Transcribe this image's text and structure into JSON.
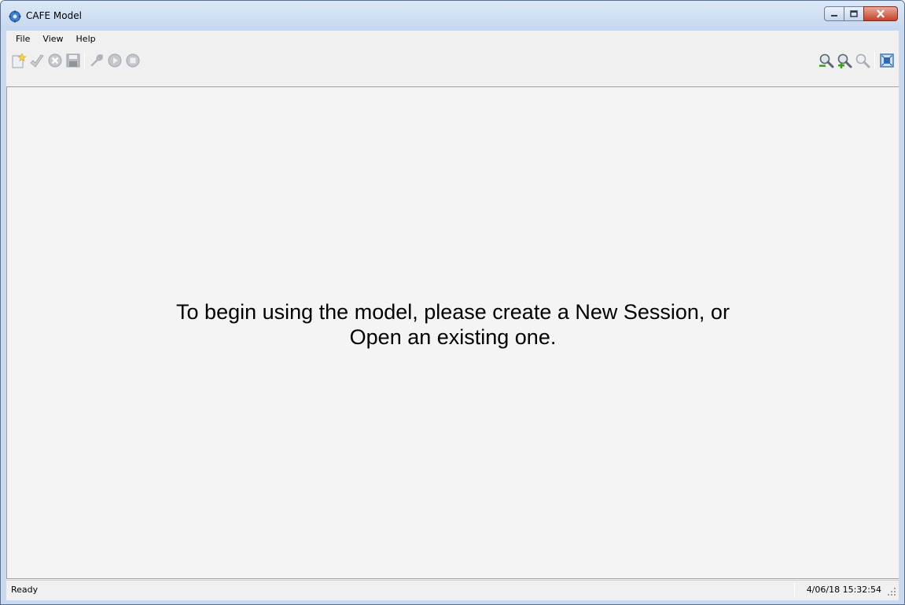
{
  "window": {
    "title": "CAFE Model"
  },
  "menu": {
    "items": [
      {
        "label": "File"
      },
      {
        "label": "View"
      },
      {
        "label": "Help"
      }
    ]
  },
  "toolbar": {
    "left_icons": [
      "new-session-icon",
      "validate-icon",
      "cancel-icon",
      "save-icon",
      "settings-wrench-icon",
      "run-icon",
      "stop-icon"
    ],
    "right_icons": [
      "zoom-out-icon",
      "zoom-in-icon",
      "zoom-reset-icon",
      "fit-to-window-icon"
    ]
  },
  "main": {
    "message_line1": "To begin using the model, please create a New Session, or",
    "message_line2": "Open an existing one."
  },
  "statusbar": {
    "status": "Ready",
    "timestamp": "4/06/18 15:32:54"
  },
  "colors": {
    "client_bg": "#f0f0f0",
    "panel_bg": "#f4f4f4",
    "close_button": "#c4412a"
  }
}
